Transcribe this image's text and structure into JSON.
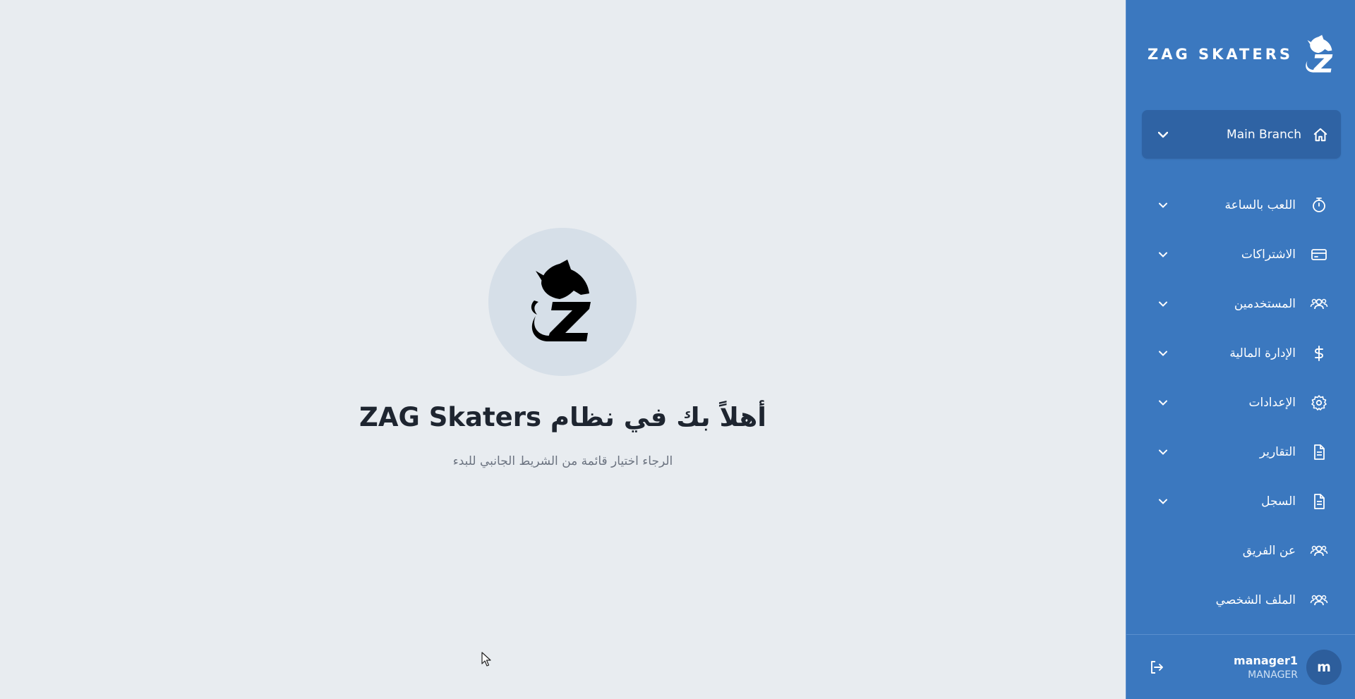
{
  "main": {
    "welcome_title": "أهلاً بك في نظام ZAG Skaters",
    "welcome_subtitle": "الرجاء اختيار قائمة من الشريط الجانبي للبدء"
  },
  "sidebar": {
    "brand_text": "ZAG SKATERS",
    "branch": {
      "label": "Main Branch",
      "icon": "home-icon"
    },
    "items": [
      {
        "label": "اللعب بالساعة",
        "icon": "stopwatch-icon",
        "has_submenu": true
      },
      {
        "label": "الاشتراكات",
        "icon": "card-icon",
        "has_submenu": true
      },
      {
        "label": "المستخدمين",
        "icon": "users-icon",
        "has_submenu": true
      },
      {
        "label": "الإدارة المالية",
        "icon": "dollar-icon",
        "has_submenu": true
      },
      {
        "label": "الإعدادات",
        "icon": "gear-icon",
        "has_submenu": true
      },
      {
        "label": "التقارير",
        "icon": "document-icon",
        "has_submenu": true
      },
      {
        "label": "السجل",
        "icon": "document-icon",
        "has_submenu": true
      },
      {
        "label": "عن الفريق",
        "icon": "users-icon",
        "has_submenu": false
      },
      {
        "label": "الملف الشخصي",
        "icon": "users-icon",
        "has_submenu": false
      }
    ],
    "user": {
      "name": "manager1",
      "role": "MANAGER",
      "avatar_letter": "m"
    }
  },
  "colors": {
    "sidebar_bg": "#3b78bf",
    "branch_bg": "#2f63a4",
    "page_bg": "#e8ecf0"
  }
}
